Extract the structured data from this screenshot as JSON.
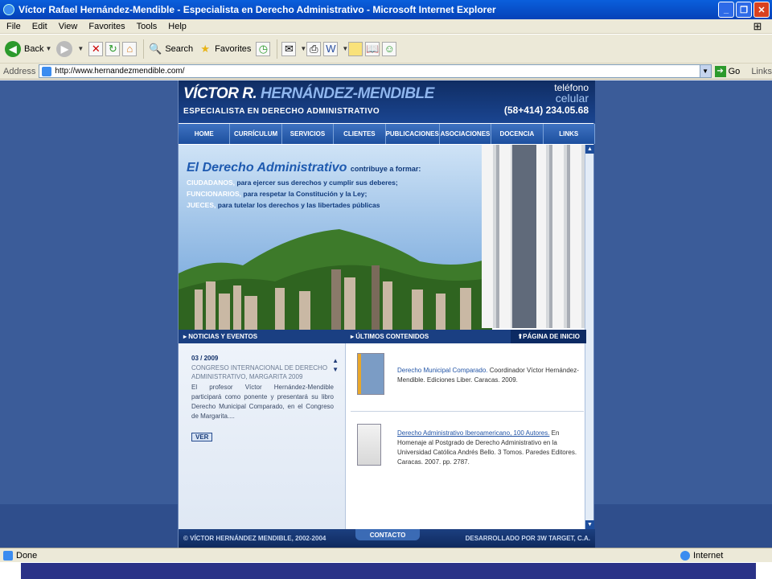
{
  "window": {
    "title": "Víctor Rafael Hernández-Mendible - Especialista en Derecho Administrativo - Microsoft Internet Explorer"
  },
  "menu": [
    "File",
    "Edit",
    "View",
    "Favorites",
    "Tools",
    "Help"
  ],
  "toolbar": {
    "back": "Back",
    "search": "Search",
    "favorites": "Favorites"
  },
  "address": {
    "label": "Address",
    "url": "http://www.hernandezmendible.com/",
    "go": "Go",
    "links": "Links"
  },
  "site": {
    "logo_name_1": "VÍCTOR R.",
    "logo_name_2": "HERNÁNDEZ-MENDIBLE",
    "logo_sub": "ESPECIALISTA EN DERECHO ADMINISTRATIVO",
    "phone_label": "teléfono",
    "phone_type": "celular",
    "phone_number": "(58+414) 234.05.68",
    "nav": [
      "HOME",
      "CURRÍCULUM",
      "SERVICIOS",
      "CLIENTES",
      "PUBLICACIONES",
      "ASOCIACIONES",
      "DOCENCIA",
      "LINKS"
    ],
    "hero": {
      "heading": "El Derecho Administrativo",
      "heading_tail": "contribuye a formar:",
      "lines": [
        {
          "k": "CIUDADANOS,",
          "v": "para ejercer sus derechos y cumplir sus deberes;"
        },
        {
          "k": "FUNCIONARIOS,",
          "v": "para respetar la Constitución y la Ley;"
        },
        {
          "k": "JUECES,",
          "v": "para tutelar los derechos y las libertades públicas"
        }
      ]
    },
    "sections": {
      "news": "NOTICIAS Y EVENTOS",
      "latest": "ÚLTIMOS CONTENIDOS",
      "home": "PÁGINA DE INICIO"
    },
    "news": {
      "date": "03 / 2009",
      "title": "CONGRESO INTERNACIONAL DE DERECHO ADMINISTRATIVO, MARGARITA 2009",
      "body": "El profesor Víctor Hernández-Mendible participará como ponente y presentará su libro Derecho Municipal Comparado, en el Congreso de Margarita....",
      "ver": "VER"
    },
    "latest": [
      {
        "link": "Derecho Municipal Comparado.",
        "rest": " Coordinador Víctor Hernández-Mendible. Ediciones Liber. Caracas. 2009."
      },
      {
        "link": "Derecho Administrativo Iberoamericano, 100 Autores.",
        "rest": " En Homenaje al Postgrado de Derecho Administrativo en la Universidad Católica Andrés Bello. 3 Tomos. Paredes Editores. Caracas. 2007. pp. 2787."
      }
    ],
    "footer": {
      "copy": "© VÍCTOR HERNÁNDEZ MENDIBLE, 2002-2004",
      "contact": "CONTACTO",
      "dev": "DESARROLLADO POR 3W TARGET, C.A."
    }
  },
  "status": {
    "text": "Done",
    "zone": "Internet"
  }
}
